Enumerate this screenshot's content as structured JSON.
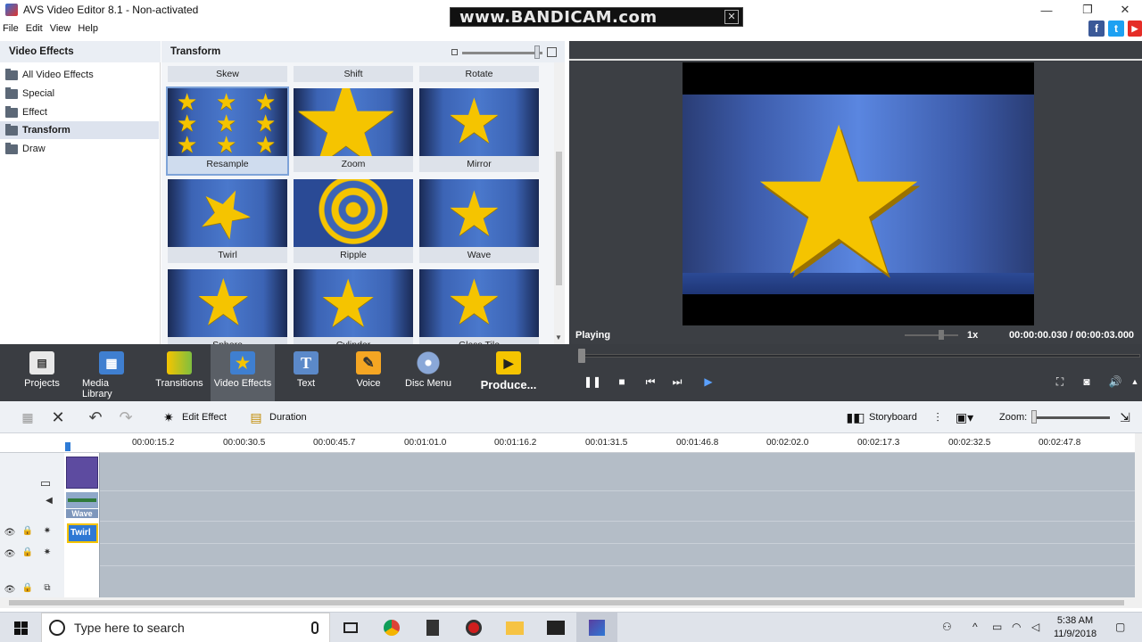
{
  "window": {
    "title": "AVS Video Editor 8.1 - Non-activated",
    "minimize": "—",
    "restore": "❐",
    "close": "✕"
  },
  "watermark": {
    "text": "www.BANDICAM.com"
  },
  "menu": [
    "File",
    "Edit",
    "View",
    "Help"
  ],
  "social": {
    "facebook": "f",
    "twitter": "t",
    "youtube": "▶"
  },
  "tree": {
    "header": "Video Effects",
    "items": [
      "All Video Effects",
      "Special",
      "Effect",
      "Transform",
      "Draw"
    ],
    "selected_index": 3
  },
  "effects": {
    "header": "Transform",
    "partial_row": [
      "Skew",
      "Shift",
      "Rotate"
    ],
    "thumbs": [
      "Resample",
      "Zoom",
      "Mirror",
      "Twirl",
      "Ripple",
      "Wave",
      "Sphere",
      "Cylinder",
      "Glass Tile"
    ],
    "selected": "Resample"
  },
  "preview": {
    "status": "Playing",
    "speed": "1x",
    "time": "00:00:00.030 / 00:00:03.000"
  },
  "toolbar": {
    "items": [
      "Projects",
      "Media Library",
      "Transitions",
      "Video Effects",
      "Text",
      "Voice",
      "Disc Menu",
      "Produce..."
    ],
    "active": "Video Effects"
  },
  "timeline_toolbar": {
    "edit_effect": "Edit Effect",
    "duration": "Duration",
    "storyboard": "Storyboard",
    "zoom_label": "Zoom:"
  },
  "ruler": [
    "00:00:15.2",
    "00:00:30.5",
    "00:00:45.7",
    "00:01:01.0",
    "00:01:16.2",
    "00:01:31.5",
    "00:01:46.8",
    "00:02:02.0",
    "00:02:17.3",
    "00:02:32.5",
    "00:02:47.8"
  ],
  "clips": {
    "wave": "Wave",
    "twirl": "Twirl"
  },
  "taskbar": {
    "search_placeholder": "Type here to search",
    "time": "5:38 AM",
    "date": "11/9/2018"
  },
  "colors": {
    "accent": "#2e78d4",
    "star": "#f5c400",
    "toolbar_bg": "#3a3d42"
  }
}
